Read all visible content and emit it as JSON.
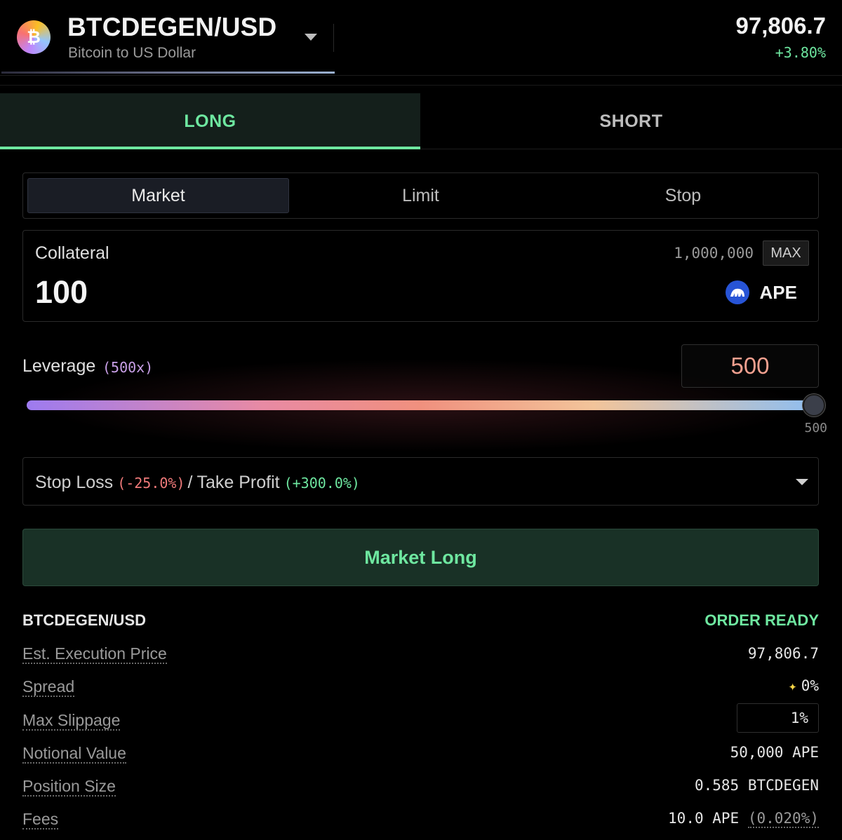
{
  "header": {
    "pair": "BTCDEGEN/USD",
    "subtitle": "Bitcoin to US Dollar",
    "coin_icon": "bitcoin-icon",
    "coin_symbol": "₿",
    "price": "97,806.7",
    "change": "+3.80%"
  },
  "tabs": {
    "long": "LONG",
    "short": "SHORT",
    "active": "LONG"
  },
  "order_types": {
    "market": "Market",
    "limit": "Limit",
    "stop": "Stop",
    "active": "Market"
  },
  "collateral": {
    "label": "Collateral",
    "balance": "1,000,000",
    "max_label": "MAX",
    "value": "100",
    "token": "APE",
    "token_icon": "ape-icon"
  },
  "leverage": {
    "label": "Leverage",
    "tag": "(500x)",
    "value": "500",
    "slider_max": "500",
    "slider_fraction": 1.0
  },
  "sltp": {
    "stop_loss_label": "Stop Loss",
    "stop_loss_value": "(-25.0%)",
    "separator": "/",
    "take_profit_label": "Take Profit",
    "take_profit_value": "(+300.0%)"
  },
  "submit": {
    "label": "Market Long"
  },
  "summary": {
    "pair": "BTCDEGEN/USD",
    "status": "ORDER READY",
    "rows": {
      "exec_price": {
        "label": "Est. Execution Price",
        "value": "97,806.7"
      },
      "spread": {
        "label": "Spread",
        "value": "0%"
      },
      "max_slippage": {
        "label": "Max Slippage",
        "value": "1%"
      },
      "notional": {
        "label": "Notional Value",
        "value": "50,000 APE"
      },
      "position_size": {
        "label": "Position Size",
        "value": "0.585 BTCDEGEN"
      },
      "fees": {
        "label": "Fees",
        "value": "10.0 APE",
        "pct": "(0.020%)"
      }
    }
  },
  "colors": {
    "accent_green": "#6ee7a0",
    "loss_red": "#f07a7a",
    "leverage_value": "#f2a08f",
    "background": "#000000"
  }
}
